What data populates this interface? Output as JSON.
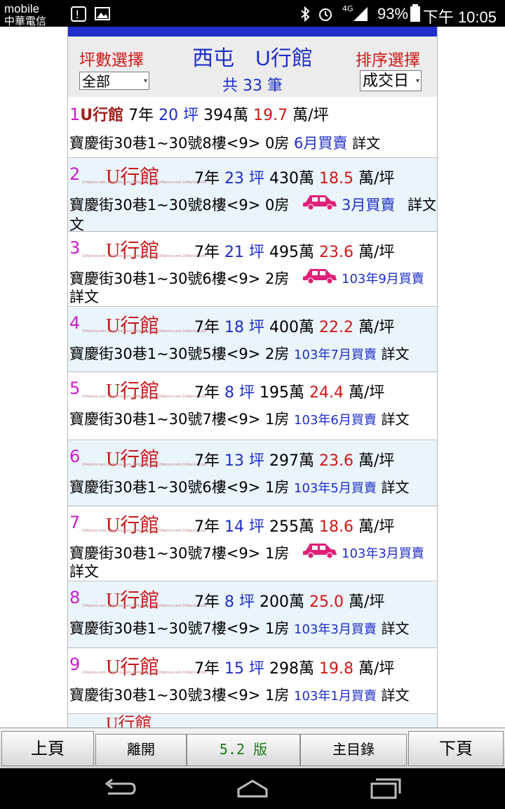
{
  "status_bar": {
    "carrier_line1": "mobile",
    "carrier_line2": "中華電信",
    "network": "4G",
    "battery": "93%",
    "time": "下午 10:05"
  },
  "header": {
    "area_label": "坪數選擇",
    "title": "西屯　U行館",
    "sort_label": "排序選擇",
    "area_select_value": "全部",
    "count": "共 33 筆",
    "sort_select_value": "成交日"
  },
  "records": [
    {
      "num": "1",
      "name": "U行館",
      "age": "7年",
      "ping": "20",
      "ping_unit": "坪",
      "price": "394萬",
      "unit_price": "19.7",
      "unit_price_unit": "萬/坪",
      "address": "寶慶街30巷1~30號8樓<9> 0房",
      "date": "6月買賣",
      "detail": "詳文",
      "car": false
    },
    {
      "num": "2",
      "name": "U行館",
      "age": "7年",
      "ping": "23",
      "ping_unit": "坪",
      "price": "430萬",
      "unit_price": "18.5",
      "unit_price_unit": "萬/坪",
      "address": "寶慶街30巷1~30號8樓<9> 0房",
      "date": "3月買賣",
      "detail": "詳文",
      "car": true
    },
    {
      "num": "3",
      "name": "U行館",
      "age": "7年",
      "ping": "21",
      "ping_unit": "坪",
      "price": "495萬",
      "unit_price": "23.6",
      "unit_price_unit": "萬/坪",
      "address": "寶慶街30巷1~30號6樓<9> 2房",
      "date": "103年9月買賣",
      "detail": "詳文",
      "car": true
    },
    {
      "num": "4",
      "name": "U行館",
      "age": "7年",
      "ping": "18",
      "ping_unit": "坪",
      "price": "400萬",
      "unit_price": "22.2",
      "unit_price_unit": "萬/坪",
      "address": "寶慶街30巷1~30號5樓<9> 2房",
      "date": "103年7月買賣",
      "detail": "詳文",
      "car": false
    },
    {
      "num": "5",
      "name": "U行館",
      "age": "7年",
      "ping": "8",
      "ping_unit": "坪",
      "price": "195萬",
      "unit_price": "24.4",
      "unit_price_unit": "萬/坪",
      "address": "寶慶街30巷1~30號7樓<9> 1房",
      "date": "103年6月買賣",
      "detail": "詳文",
      "car": false
    },
    {
      "num": "6",
      "name": "U行館",
      "age": "7年",
      "ping": "13",
      "ping_unit": "坪",
      "price": "297萬",
      "unit_price": "23.6",
      "unit_price_unit": "萬/坪",
      "address": "寶慶街30巷1~30號6樓<9> 1房",
      "date": "103年5月買賣",
      "detail": "詳文",
      "car": false
    },
    {
      "num": "7",
      "name": "U行館",
      "age": "7年",
      "ping": "14",
      "ping_unit": "坪",
      "price": "255萬",
      "unit_price": "18.6",
      "unit_price_unit": "萬/坪",
      "address": "寶慶街30巷1~30號7樓<9> 1房",
      "date": "103年3月買賣",
      "detail": "詳文",
      "car": true
    },
    {
      "num": "8",
      "name": "U行館",
      "age": "7年",
      "ping": "8",
      "ping_unit": "坪",
      "price": "200萬",
      "unit_price": "25.0",
      "unit_price_unit": "萬/坪",
      "address": "寶慶街30巷1~30號7樓<9> 1房",
      "date": "103年3月買賣",
      "detail": "詳文",
      "car": false
    },
    {
      "num": "9",
      "name": "U行館",
      "age": "7年",
      "ping": "15",
      "ping_unit": "坪",
      "price": "298萬",
      "unit_price": "19.8",
      "unit_price_unit": "萬/坪",
      "address": "寶慶街30巷1~30號3樓<9> 1房",
      "date": "103年1月買賣",
      "detail": "詳文",
      "car": false
    }
  ],
  "logo": {
    "brand": "U行館",
    "watermark": "104price.com.104price.com.104price.com.104price.com.104price.com"
  },
  "bottom_bar": {
    "prev": "上頁",
    "leave": "離開",
    "version": "5.2 版",
    "main_menu": "主目錄",
    "next": "下頁"
  },
  "colors": {
    "accent_blue": "#1e2ec8",
    "accent_red": "#d01818",
    "index_magenta": "#c81ec8",
    "car_pink": "#e0207a"
  }
}
